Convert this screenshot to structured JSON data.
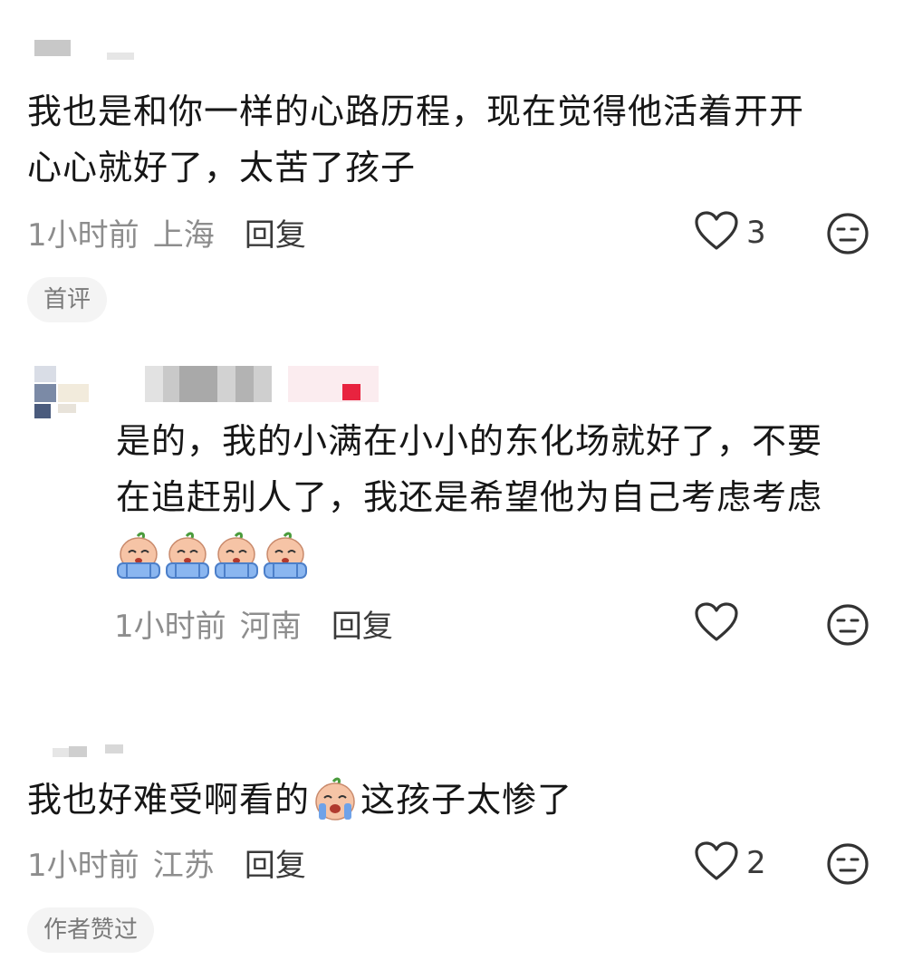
{
  "comments": [
    {
      "text": "我也是和你一样的心路历程，现在觉得他活着开开心心就好了，太苦了孩子",
      "line1": "我也是和你一样的心路历程，现在觉得他活着开开",
      "line2": "心心就好了，太苦了孩子",
      "time": "1小时前",
      "location": "上海",
      "reply_label": "回复",
      "likes": "3",
      "badge": "首评"
    },
    {
      "line1": "是的，我的小满在小小的东化场就好了，不要",
      "line2": "在追赶别人了，我还是希望他为自己考虑考虑",
      "emoji": [
        "crying-emoji",
        "crying-emoji",
        "crying-emoji",
        "crying-emoji"
      ],
      "time": "1小时前",
      "location": "河南",
      "reply_label": "回复"
    },
    {
      "text_before": "我也好难受啊看的",
      "emoji": "crying-emoji",
      "text_after": "这孩子太惨了",
      "time": "1小时前",
      "location": "江苏",
      "reply_label": "回复",
      "likes": "2",
      "badge": "作者赞过"
    }
  ],
  "icons": {
    "like": "heart-outline-icon",
    "dislike": "neutral-face-icon"
  }
}
